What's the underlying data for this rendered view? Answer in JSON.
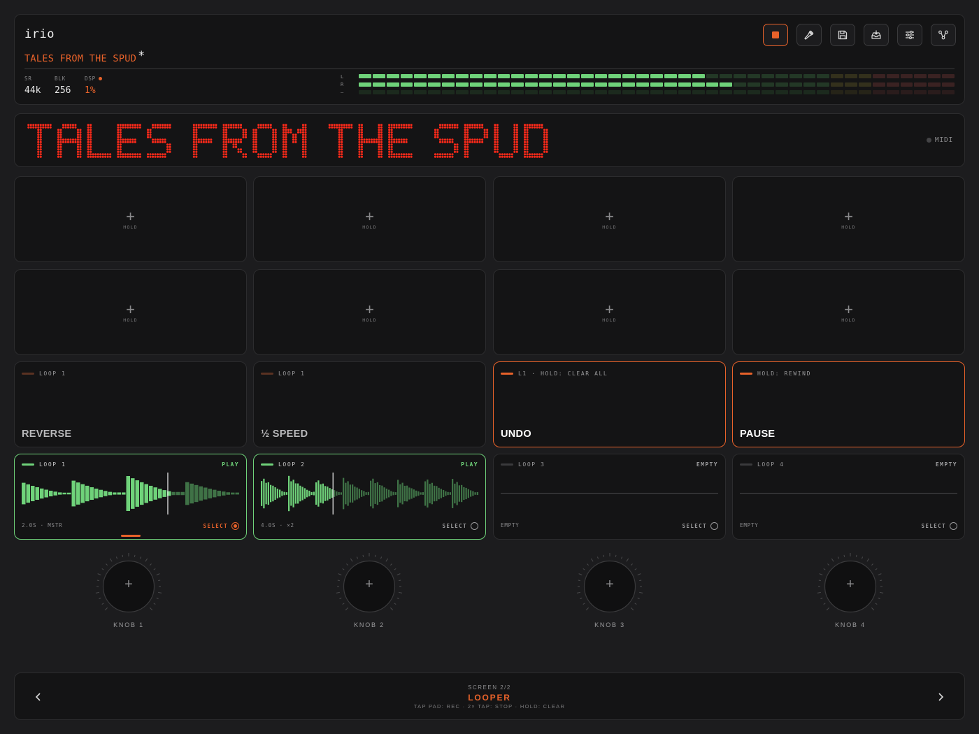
{
  "header": {
    "app_title": "irio",
    "project_title": "TALES FROM THE SPUD",
    "dirty_marker": "*",
    "stats": [
      {
        "label": "SR",
        "value": "44k"
      },
      {
        "label": "BLK",
        "value": "256"
      },
      {
        "label": "DSP",
        "value": "1%"
      }
    ],
    "meter": {
      "labels": [
        "L",
        "R",
        "—"
      ],
      "left_level": 0.58,
      "right_level": 0.63,
      "aux_level": 0.0
    },
    "toolbar": [
      {
        "icon": "stop-icon",
        "active": true
      },
      {
        "icon": "tuning-fork-icon",
        "active": false
      },
      {
        "icon": "save-icon",
        "active": false
      },
      {
        "icon": "inbox-download-icon",
        "active": false
      },
      {
        "icon": "sliders-icon",
        "active": false
      },
      {
        "icon": "node-graph-icon",
        "active": false
      }
    ]
  },
  "display": {
    "text": "TALES FROM THE SPUD",
    "led_color": "#ff2a1a",
    "midi_label": "MIDI"
  },
  "pads": {
    "empty_label": "HOLD",
    "empty_symbol": "+",
    "fx": [
      {
        "tag": "LOOP 1",
        "name": "REVERSE",
        "hot": false
      },
      {
        "tag": "LOOP 1",
        "name": "½ SPEED",
        "hot": false
      },
      {
        "tag": "L1 · HOLD: CLEAR ALL",
        "name": "UNDO",
        "hot": true
      },
      {
        "tag": "HOLD: REWIND",
        "name": "PAUSE",
        "hot": true
      }
    ],
    "loops": [
      {
        "tag": "LOOP 1",
        "state": "PLAY",
        "info": "2.0S · MSTR",
        "select": "SELECT",
        "playing": true,
        "selected": true,
        "playhead": 0.67
      },
      {
        "tag": "LOOP 2",
        "state": "PLAY",
        "info": "4.0S · ×2",
        "select": "SELECT",
        "playing": true,
        "selected": false,
        "playhead": 0.33
      },
      {
        "tag": "LOOP 3",
        "state": "EMPTY",
        "info": "EMPTY",
        "select": "SELECT",
        "playing": false,
        "selected": false
      },
      {
        "tag": "LOOP 4",
        "state": "EMPTY",
        "info": "EMPTY",
        "select": "SELECT",
        "playing": false,
        "selected": false
      }
    ]
  },
  "knobs": [
    {
      "label": "KNOB 1",
      "symbol": "+"
    },
    {
      "label": "KNOB 2",
      "symbol": "+"
    },
    {
      "label": "KNOB 3",
      "symbol": "+"
    },
    {
      "label": "KNOB 4",
      "symbol": "+"
    }
  ],
  "footer": {
    "screen_label": "SCREEN 2/2",
    "screen_name": "LOOPER",
    "hint": "TAP PAD: REC · 2× TAP: STOP · HOLD: CLEAR",
    "prev_icon": "chevron-left-icon",
    "next_icon": "chevron-right-icon"
  },
  "colors": {
    "accent": "#e8622a",
    "play": "#6fd27a",
    "meter_green": "#6fd27a"
  }
}
